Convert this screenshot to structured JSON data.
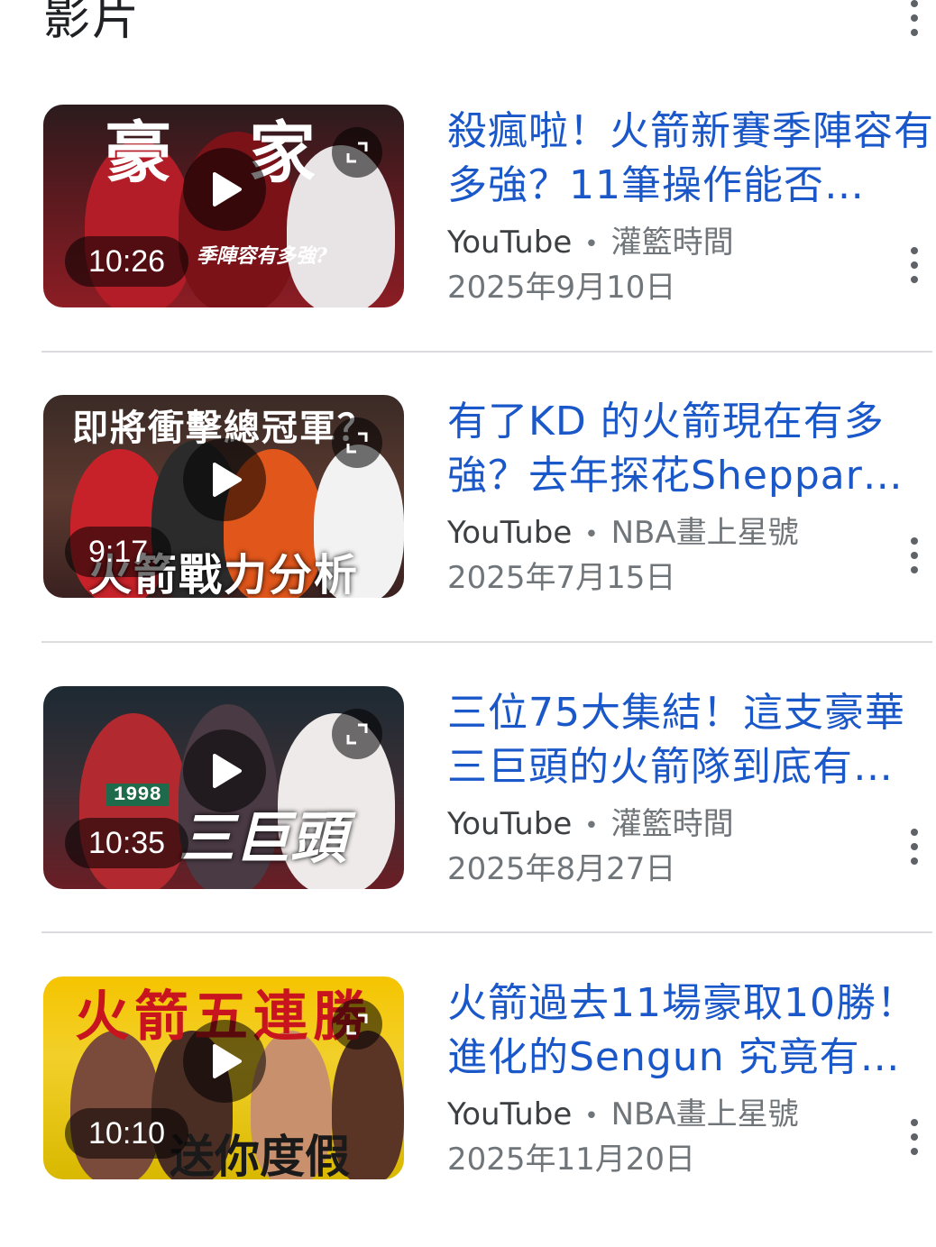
{
  "header": {
    "title": "影片",
    "more_icon": "more-vert-icon"
  },
  "videos": [
    {
      "title": "殺瘋啦！火箭新賽季陣容有多強？11筆操作能否…",
      "source": "YouTube",
      "channel": "灌籃時間",
      "date": "2025年9月10日",
      "duration": "10:26",
      "thumb_caption_top": "豪 家",
      "thumb_caption_bottom": "季陣容有多強?"
    },
    {
      "title": "有了KD 的火箭現在有多強？去年探花Sheppar…",
      "source": "YouTube",
      "channel": "NBA畫上星號",
      "date": "2025年7月15日",
      "duration": "9:17",
      "thumb_caption_top": "即將衝擊總冠軍？",
      "thumb_caption_bottom": "火箭戰力分析"
    },
    {
      "title": "三位75大集結！這支豪華三巨頭的火箭隊到底有…",
      "source": "YouTube",
      "channel": "灌籃時間",
      "date": "2025年8月27日",
      "duration": "10:35",
      "thumb_caption_top": "1998",
      "thumb_caption_bottom": "三巨頭"
    },
    {
      "title": "火箭過去11場豪取10勝！進化的Sengun 究竟有…",
      "source": "YouTube",
      "channel": "NBA畫上星號",
      "date": "2025年11月20日",
      "duration": "10:10",
      "thumb_caption_top": "火箭五連勝",
      "thumb_caption_bottom": "送你度假"
    }
  ],
  "icons": {
    "play": "play-icon",
    "expand": "fullscreen-icon",
    "more": "more-vert-icon"
  },
  "colors": {
    "title_link": "#1a57c9",
    "meta_text": "#70757a",
    "divider": "#dadce0"
  }
}
